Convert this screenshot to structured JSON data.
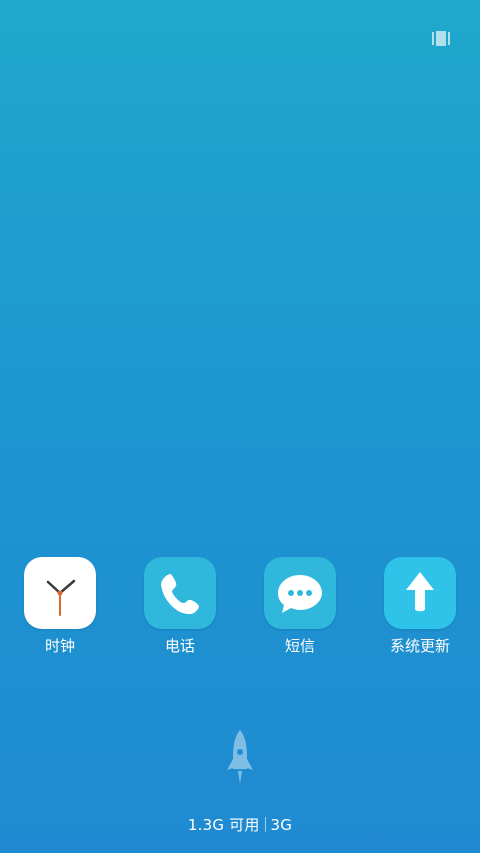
{
  "status_bar": {
    "indicator_icon": "recents-icon"
  },
  "home": {
    "apps": [
      {
        "label": "时钟",
        "icon": "clock-icon",
        "bg": "#ffffff"
      },
      {
        "label": "电话",
        "icon": "phone-icon",
        "bg": "#2fb8dc"
      },
      {
        "label": "短信",
        "icon": "message-icon",
        "bg": "#2fb8dc"
      },
      {
        "label": "系统更新",
        "icon": "update-arrow-icon",
        "bg": "#2fc3ea"
      }
    ]
  },
  "cleaner": {
    "rocket_icon": "rocket-icon",
    "memory_text": "1.3G 可用",
    "network_text": "3G"
  },
  "colors": {
    "background_top": "#1fa8cc",
    "background_bottom": "#1f8ad1",
    "clock_hour_hand": "#3a3a3a",
    "clock_second_hand": "#e0652f"
  }
}
